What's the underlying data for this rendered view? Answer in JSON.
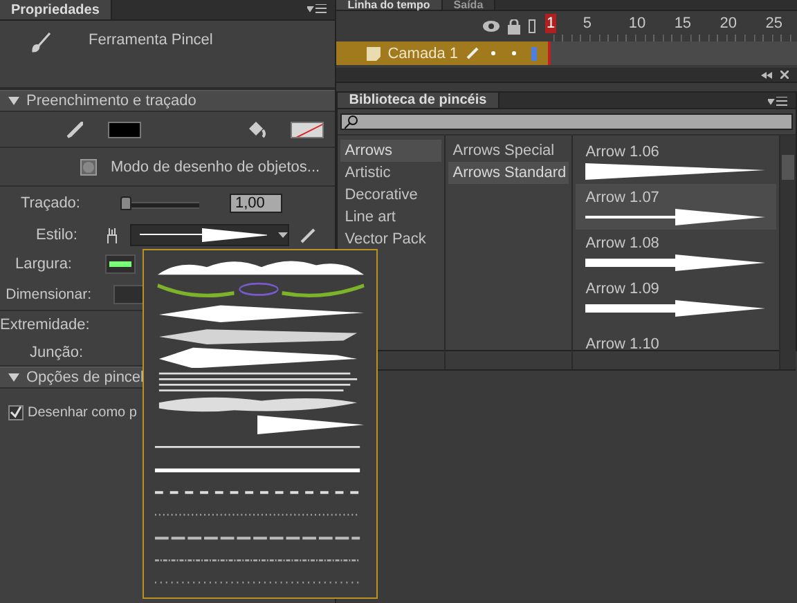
{
  "properties": {
    "tab": "Propriedades",
    "tool_name": "Ferramenta Pincel",
    "sections": [
      {
        "title": "Preenchimento e traçado",
        "expanded": true
      },
      {
        "title": "Opções de pincel",
        "expanded": true
      }
    ],
    "object_mode": "Modo de desenho de objetos...",
    "stroke": {
      "label": "Traçado:",
      "level": 0.0,
      "value": "1,00"
    },
    "style_label": "Estilo:",
    "width_label": "Largura:",
    "scale_label": "Dimensionar:",
    "cap_label": "Extremidade:",
    "join_label": "Junção:",
    "draw_option": {
      "label": "Desenhar como p",
      "checked": true
    }
  },
  "timeline": {
    "tabs": [
      {
        "label": "Linha do tempo",
        "selected": true
      },
      {
        "label": "Saída",
        "selected": false
      }
    ],
    "frames": [
      {
        "label": "1",
        "selected": true
      },
      {
        "label": "5",
        "selected": false
      },
      {
        "label": "10",
        "selected": false
      },
      {
        "label": "15",
        "selected": false
      },
      {
        "label": "20",
        "selected": false
      },
      {
        "label": "25",
        "selected": false
      }
    ],
    "layers": [
      {
        "name": "Camada 1",
        "selected": true,
        "color": "#4f7fdc"
      }
    ]
  },
  "brush_library": {
    "tab": "Biblioteca de pincéis",
    "categories": [
      {
        "label": "Arrows",
        "selected": true
      },
      {
        "label": "Artistic",
        "selected": false
      },
      {
        "label": "Decorative",
        "selected": false
      },
      {
        "label": "Line art",
        "selected": false
      },
      {
        "label": "Vector Pack",
        "selected": false
      }
    ],
    "subcategories": [
      {
        "label": "Arrows Special",
        "selected": false
      },
      {
        "label": "Arrows Standard",
        "selected": true
      }
    ],
    "brushes": [
      {
        "name": "Arrow 1.06",
        "kind": "taper",
        "selected": false
      },
      {
        "name": "Arrow 1.07",
        "kind": "thin-arrow",
        "selected": true
      },
      {
        "name": "Arrow 1.08",
        "kind": "thick-arrow",
        "selected": false
      },
      {
        "name": "Arrow 1.09",
        "kind": "thick-arrow",
        "selected": false
      },
      {
        "name": "Arrow 1.10",
        "kind": "none",
        "selected": false
      }
    ]
  }
}
